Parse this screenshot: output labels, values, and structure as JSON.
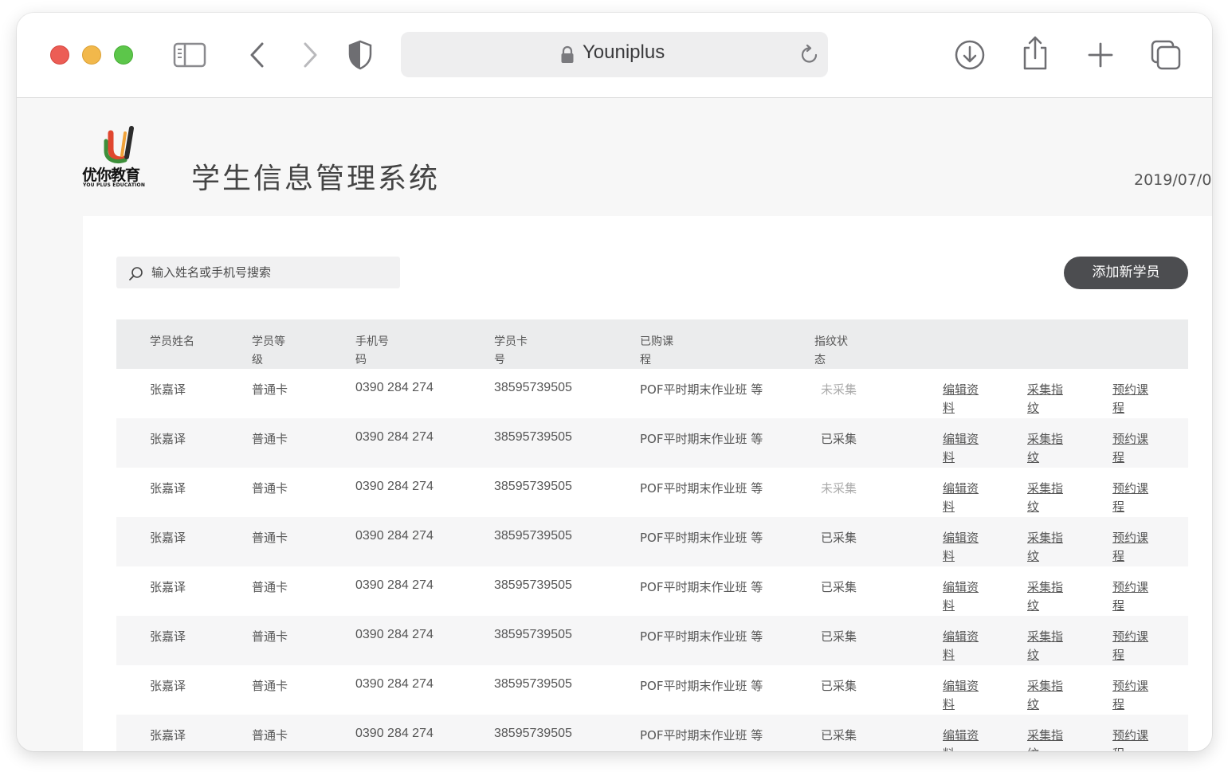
{
  "browser": {
    "url_text": "Youniplus"
  },
  "brand": {
    "logo_cn": "优你教育",
    "logo_en": "YOU PLUS EDUCATION"
  },
  "header": {
    "title": "学生信息管理系统",
    "date": "2019/07/0"
  },
  "search": {
    "placeholder": "输入姓名或手机号搜索"
  },
  "add_button_label": "添加新学员",
  "table": {
    "columns": [
      {
        "l1": "学员姓名",
        "l2": ""
      },
      {
        "l1": "学员等",
        "l2": "级"
      },
      {
        "l1": "手机号",
        "l2": "码"
      },
      {
        "l1": "学员卡",
        "l2": "号"
      },
      {
        "l1": "已购课",
        "l2": "程"
      },
      {
        "l1": "指纹状",
        "l2": "态"
      }
    ],
    "actions": [
      {
        "l1": "编辑资",
        "l2": "料"
      },
      {
        "l1": "采集指",
        "l2": "纹"
      },
      {
        "l1": "预约课",
        "l2": "程"
      }
    ],
    "rows": [
      {
        "name": "张嘉译",
        "level": "普通卡",
        "phone": "0390 284 274",
        "card": "38595739505",
        "course": "POF平时期末作业班 等",
        "status": "未采集",
        "collected": false
      },
      {
        "name": "张嘉译",
        "level": "普通卡",
        "phone": "0390 284 274",
        "card": "38595739505",
        "course": "POF平时期末作业班 等",
        "status": "已采集",
        "collected": true
      },
      {
        "name": "张嘉译",
        "level": "普通卡",
        "phone": "0390 284 274",
        "card": "38595739505",
        "course": "POF平时期末作业班 等",
        "status": "未采集",
        "collected": false
      },
      {
        "name": "张嘉译",
        "level": "普通卡",
        "phone": "0390 284 274",
        "card": "38595739505",
        "course": "POF平时期末作业班 等",
        "status": "已采集",
        "collected": true
      },
      {
        "name": "张嘉译",
        "level": "普通卡",
        "phone": "0390 284 274",
        "card": "38595739505",
        "course": "POF平时期末作业班 等",
        "status": "已采集",
        "collected": true
      },
      {
        "name": "张嘉译",
        "level": "普通卡",
        "phone": "0390 284 274",
        "card": "38595739505",
        "course": "POF平时期末作业班 等",
        "status": "已采集",
        "collected": true
      },
      {
        "name": "张嘉译",
        "level": "普通卡",
        "phone": "0390 284 274",
        "card": "38595739505",
        "course": "POF平时期末作业班 等",
        "status": "已采集",
        "collected": true
      },
      {
        "name": "张嘉译",
        "level": "普通卡",
        "phone": "0390 284 274",
        "card": "38595739505",
        "course": "POF平时期末作业班 等",
        "status": "已采集",
        "collected": true
      }
    ]
  },
  "colors": {
    "button_bg": "#4c4d50",
    "status_pending": "#aaaaaa",
    "status_done": "#555555"
  },
  "icons": {
    "sidebar": "sidebar-icon",
    "back": "chevron-left-icon",
    "forward": "chevron-right-icon",
    "shield": "shield-icon",
    "lock": "lock-icon",
    "reload": "reload-icon",
    "download": "download-icon",
    "share": "share-icon",
    "new_tab": "plus-icon",
    "tabs": "tabs-icon",
    "search": "search-icon"
  }
}
